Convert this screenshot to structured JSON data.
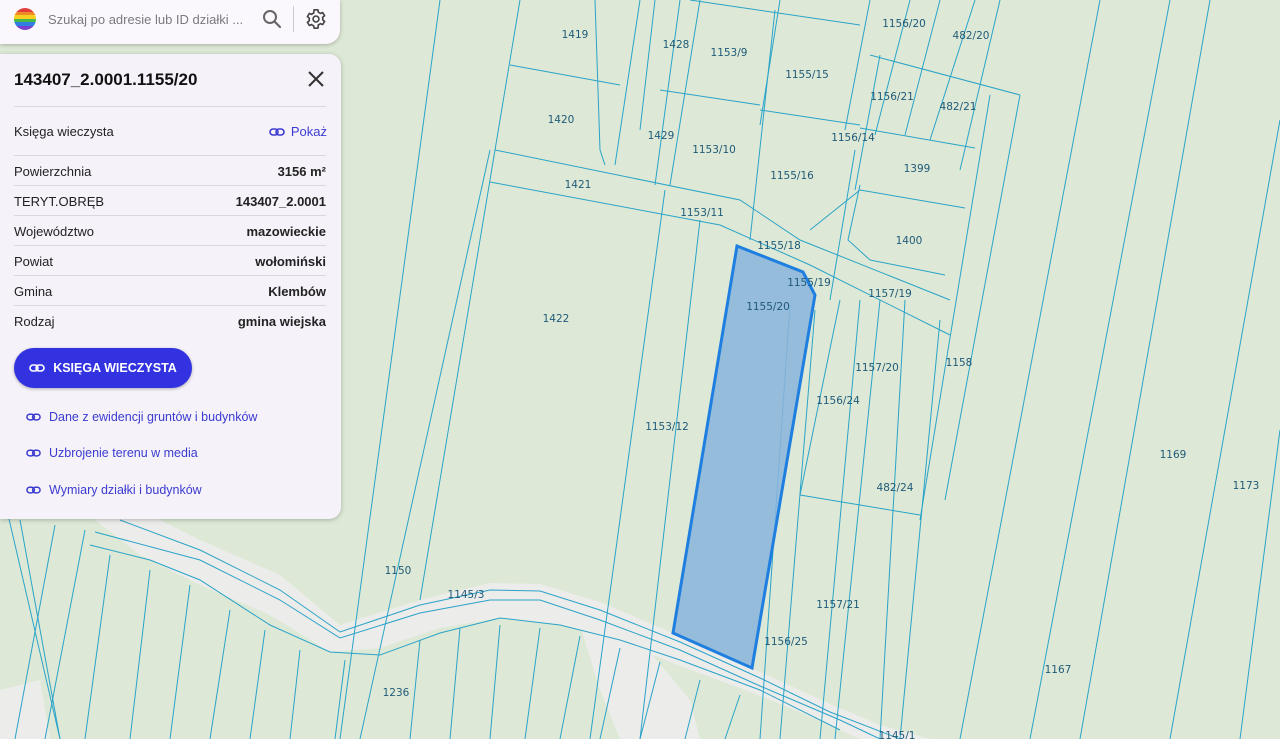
{
  "search": {
    "placeholder": "Szukaj po adresie lub ID działki ..."
  },
  "panel": {
    "title": "143407_2.0001.1155/20",
    "kw_label": "Księga wieczysta",
    "kw_link": "Pokaż",
    "rows": [
      {
        "label": "Powierzchnia",
        "value": "3156 m²"
      },
      {
        "label": "TERYT.OBRĘB",
        "value": "143407_2.0001"
      },
      {
        "label": "Województwo",
        "value": "mazowieckie"
      },
      {
        "label": "Powiat",
        "value": "wołomiński"
      },
      {
        "label": "Gmina",
        "value": "Klembów"
      },
      {
        "label": "Rodzaj",
        "value": "gmina wiejska"
      }
    ],
    "button": "KSIĘGA WIECZYSTA",
    "links": [
      "Dane z ewidencji gruntów i budynków",
      "Uzbrojenie terenu w media",
      "Wymiary działki i budynków"
    ]
  },
  "map": {
    "parcels": [
      "1419",
      "1428",
      "1153/9",
      "1156/20",
      "482/20",
      "1155/15",
      "1156/21",
      "482/21",
      "1420",
      "1429",
      "1153/10",
      "1156/14",
      "1155/16",
      "1399",
      "1421",
      "1153/11",
      "1155/18",
      "1400",
      "1155/19",
      "1157/19",
      "1155/20",
      "1422",
      "1157/20",
      "1158",
      "1156/24",
      "1153/12",
      "1169",
      "482/24",
      "1173",
      "1150",
      "1145/3",
      "1157/21",
      "1156/25",
      "1236",
      "1167",
      "1145/1"
    ],
    "colors": {
      "background": "#dde9d6",
      "lines": "#2aa3c8",
      "road": "#ececea",
      "selected_fill": "#8ab4dc",
      "selected_stroke": "#1f7fe0"
    }
  }
}
